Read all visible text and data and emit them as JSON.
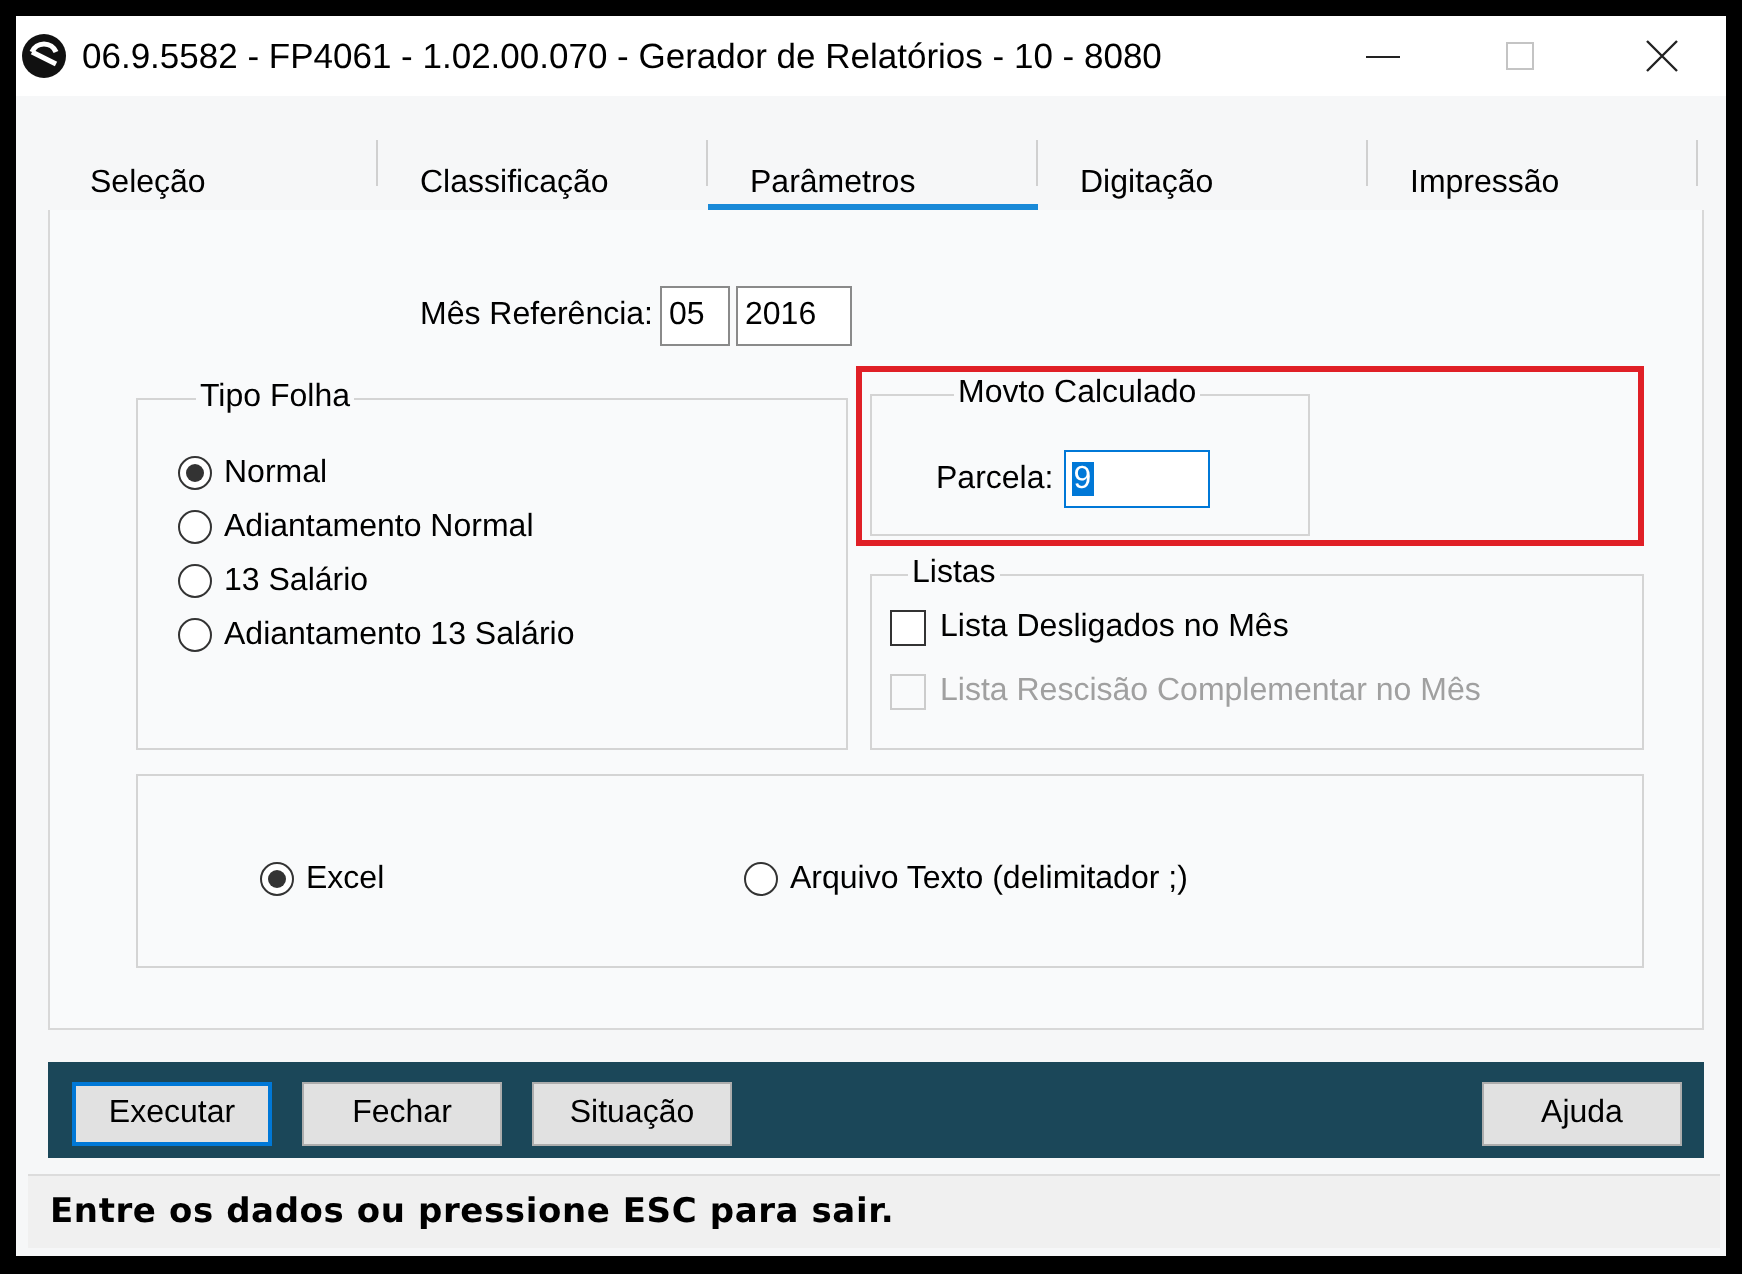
{
  "window": {
    "title": "06.9.5582 - FP4061 - 1.02.00.070 - Gerador de Relatórios - 10 - 8080",
    "maximize_disabled": true
  },
  "tabs": [
    {
      "label": "Seleção",
      "selected": false
    },
    {
      "label": "Classificação",
      "selected": false
    },
    {
      "label": "Parâmetros",
      "selected": true
    },
    {
      "label": "Digitação",
      "selected": false
    },
    {
      "label": "Impressão",
      "selected": false
    }
  ],
  "reference_month": {
    "label": "Mês Referência:",
    "month": "05",
    "year": "2016"
  },
  "tipo_folha": {
    "title": "Tipo Folha",
    "options": [
      {
        "label": "Normal",
        "selected": true
      },
      {
        "label": "Adiantamento Normal",
        "selected": false
      },
      {
        "label": "13 Salário",
        "selected": false
      },
      {
        "label": "Adiantamento 13 Salário",
        "selected": false
      }
    ]
  },
  "movto_calculado": {
    "title": "Movto Calculado",
    "highlighted": true,
    "parcela": {
      "label": "Parcela:",
      "value": "9",
      "value_selected": true
    }
  },
  "listas": {
    "title": "Listas",
    "items": [
      {
        "label": "Lista Desligados no Mês",
        "checked": false,
        "disabled": false
      },
      {
        "label": "Lista Rescisão Complementar no Mês",
        "checked": false,
        "disabled": true
      }
    ]
  },
  "output_format": {
    "options": [
      {
        "label": "Excel",
        "selected": true
      },
      {
        "label": "Arquivo Texto (delimitador ;)",
        "selected": false
      }
    ]
  },
  "button_bar": {
    "left": [
      {
        "label": "Executar",
        "focused": true
      },
      {
        "label": "Fechar",
        "focused": false
      },
      {
        "label": "Situação",
        "focused": false
      }
    ],
    "right": [
      {
        "label": "Ajuda",
        "focused": false
      }
    ]
  },
  "status_bar": {
    "text": "Entre os dados ou pressione ESC para sair."
  }
}
